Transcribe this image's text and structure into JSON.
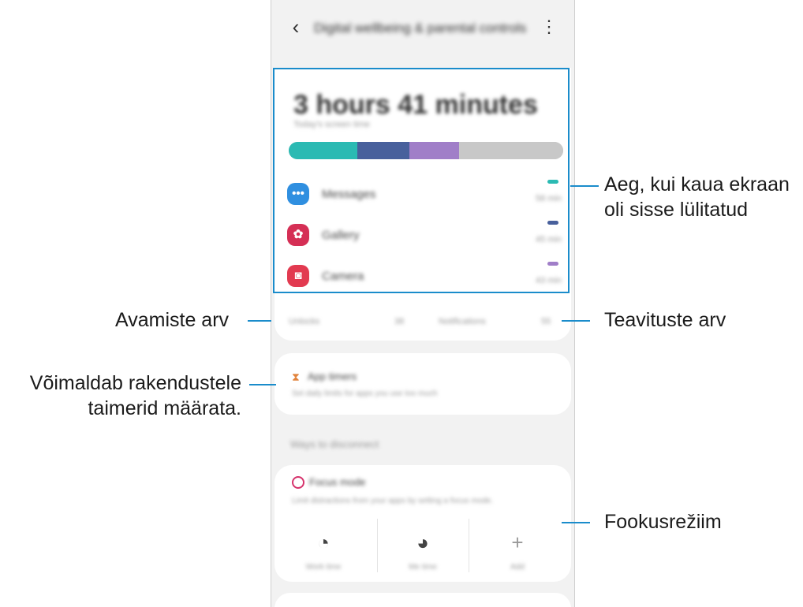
{
  "header": {
    "back_icon": "back-arrow-icon",
    "title": "Digital wellbeing & parental controls",
    "more_icon": "more-vertical-icon"
  },
  "usage": {
    "total_time": "3 hours 41 minutes",
    "subtitle": "Today's screen time",
    "bar_segments": [
      {
        "color": "#2bbab3",
        "fraction": 0.25
      },
      {
        "color": "#48609c",
        "fraction": 0.19
      },
      {
        "color": "#a07ec8",
        "fraction": 0.18
      },
      {
        "color": "#c8c8c8",
        "fraction": 0.38
      }
    ],
    "apps": [
      {
        "name": "Messages",
        "time": "58 min",
        "icon": "chat-bubble-icon",
        "icon_color": "#2f8fe0",
        "dash_color": "#2bbab3"
      },
      {
        "name": "Gallery",
        "time": "45 min",
        "icon": "flower-icon",
        "icon_color": "#d52f55",
        "dash_color": "#48609c"
      },
      {
        "name": "Camera",
        "time": "43 min",
        "icon": "camera-icon",
        "icon_color": "#e23a50",
        "dash_color": "#a07ec8"
      }
    ],
    "unlocks_label": "Unlocks",
    "unlocks_value": "38",
    "notifications_label": "Notifications",
    "notifications_value": "55"
  },
  "app_timers": {
    "icon": "hourglass-icon",
    "title": "App timers",
    "subtitle": "Set daily limits for apps you use too much"
  },
  "section_title": "Ways to disconnect",
  "focus_mode": {
    "icon": "target-icon",
    "title": "Focus mode",
    "subtitle": "Limit distractions from your apps by setting a focus mode.",
    "options": [
      {
        "label": "Work time",
        "icon": "work-focus-icon"
      },
      {
        "label": "Me time",
        "icon": "me-focus-icon"
      },
      {
        "label": "Add",
        "icon": "plus-icon"
      }
    ]
  },
  "callouts": {
    "screen_time": [
      "Aeg, kui kaua ekraan",
      "oli sisse lülitatud"
    ],
    "unlocks": "Avamiste arv",
    "notifications": "Teavituste arv",
    "timers": [
      "Võimaldab rakendustele",
      "taimerid määrata."
    ],
    "focus": "Fookusrežiim"
  },
  "accent_color": "#1a8ccb"
}
